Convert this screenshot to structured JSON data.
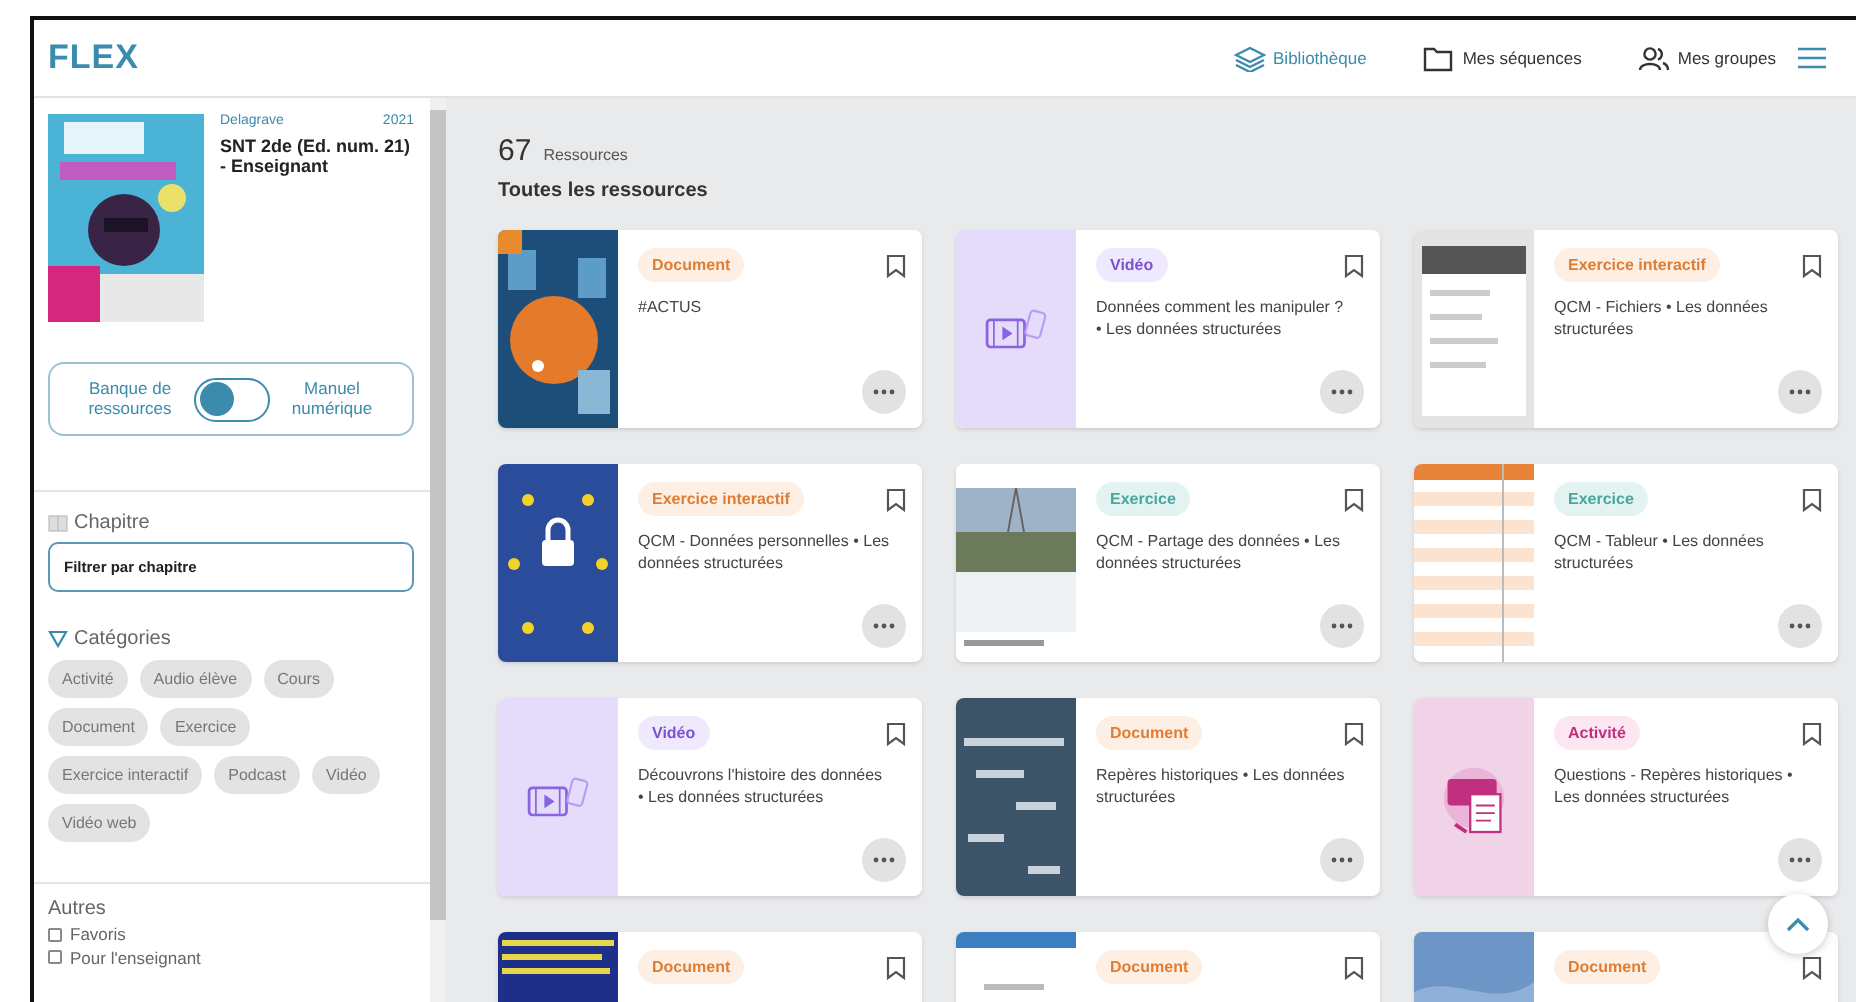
{
  "header": {
    "logo": "FLEX",
    "nav": [
      {
        "label": "Bibliothèque",
        "selected": true
      },
      {
        "label": "Mes séquences",
        "selected": false
      },
      {
        "label": "Mes groupes",
        "selected": false
      }
    ]
  },
  "sidebar": {
    "book": {
      "publisher": "Delagrave",
      "year": "2021",
      "title": "SNT 2de (Ed. num. 21) - Enseignant"
    },
    "mode_switch": {
      "left_label": "Banque de ressources",
      "right_label": "Manuel numérique",
      "on": false
    },
    "chapter": {
      "label": "Chapitre",
      "placeholder": "Filtrer par chapitre"
    },
    "categories": {
      "label": "Catégories",
      "chips": [
        {
          "label": "Activité",
          "selected": false
        },
        {
          "label": "Audio élève",
          "selected": false
        },
        {
          "label": "Cours",
          "selected": false
        },
        {
          "label": "Document",
          "selected": false
        },
        {
          "label": "Exercice",
          "selected": false
        },
        {
          "label": "Exercice interactif",
          "selected": false
        },
        {
          "label": "Podcast",
          "selected": false
        },
        {
          "label": "Vidéo",
          "selected": false
        },
        {
          "label": "Vidéo web",
          "selected": false
        }
      ]
    },
    "others": {
      "label": "Autres",
      "options": [
        {
          "label": "Favoris",
          "checked": false
        },
        {
          "label": "Pour l'enseignant",
          "checked": false
        }
      ]
    }
  },
  "main": {
    "count": "67",
    "count_label": "Ressources",
    "heading": "Toutes les ressources",
    "cards": [
      {
        "tag": "Document",
        "kind": "document",
        "title": "#ACTUS",
        "bookmarked": false
      },
      {
        "tag": "Vidéo",
        "kind": "video",
        "title": "Données comment les manipuler ? • Les données structurées",
        "bookmarked": false
      },
      {
        "tag": "Exercice interactif",
        "kind": "interactive",
        "title": "QCM - Fichiers • Les données structurées",
        "bookmarked": false
      },
      {
        "tag": "Exercice interactif",
        "kind": "interactive",
        "title": "QCM - Données personnelles • Les données structurées",
        "bookmarked": false
      },
      {
        "tag": "Exercice",
        "kind": "exercise",
        "title": "QCM - Partage des données • Les données structurées",
        "bookmarked": false
      },
      {
        "tag": "Exercice",
        "kind": "exercise",
        "title": "QCM - Tableur • Les données structurées",
        "bookmarked": false
      },
      {
        "tag": "Vidéo",
        "kind": "video",
        "title": "Découvrons l'histoire des données • Les données structurées",
        "bookmarked": false
      },
      {
        "tag": "Document",
        "kind": "document",
        "title": "Repères historiques • Les données structurées",
        "bookmarked": false
      },
      {
        "tag": "Activité",
        "kind": "activity",
        "title": "Questions - Repères historiques • Les données structurées",
        "bookmarked": false
      },
      {
        "tag": "Document",
        "kind": "document",
        "bookmarked": false
      },
      {
        "tag": "Document",
        "kind": "document",
        "bookmarked": false
      },
      {
        "tag": "Document",
        "kind": "document",
        "bookmarked": false
      }
    ]
  }
}
